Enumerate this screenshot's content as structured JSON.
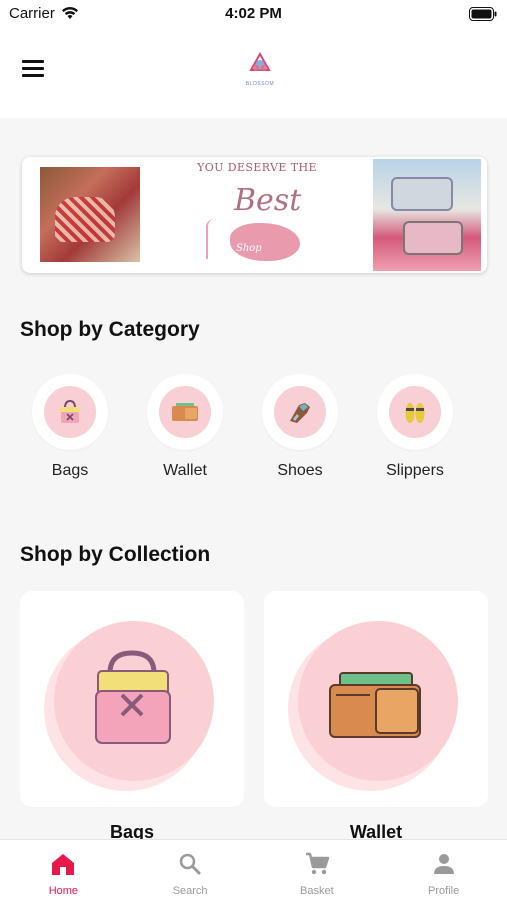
{
  "status_bar": {
    "carrier": "Carrier",
    "time": "4:02 PM"
  },
  "header": {
    "logo_text": "BLOSSOM",
    "menu_icon": "hamburger-menu-icon"
  },
  "banner": {
    "headline": "YOU DESERVE THE",
    "script_text": "Best",
    "shop_text": "Shop"
  },
  "categories": {
    "title": "Shop by Category",
    "items": [
      {
        "label": "Bags",
        "icon": "handbag-icon"
      },
      {
        "label": "Wallet",
        "icon": "wallet-icon"
      },
      {
        "label": "Shoes",
        "icon": "shoe-icon"
      },
      {
        "label": "Slippers",
        "icon": "slippers-icon"
      }
    ]
  },
  "collections": {
    "title": "Shop by Collection",
    "items": [
      {
        "label": "Bags",
        "icon": "handbag-icon"
      },
      {
        "label": "Wallet",
        "icon": "wallet-icon"
      }
    ]
  },
  "tab_bar": {
    "active_color": "#e6194b",
    "inactive_color": "#9a9a9a",
    "items": [
      {
        "label": "Home",
        "icon": "home-icon",
        "active": true
      },
      {
        "label": "Search",
        "icon": "search-icon",
        "active": false
      },
      {
        "label": "Basket",
        "icon": "cart-icon",
        "active": false
      },
      {
        "label": "Profile",
        "icon": "person-icon",
        "active": false
      }
    ]
  }
}
